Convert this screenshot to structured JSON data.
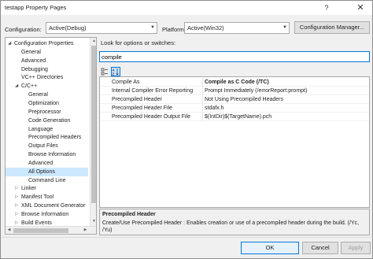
{
  "window": {
    "title": "testapp Property Pages",
    "help_glyph": "?",
    "close_glyph": "✕"
  },
  "config_bar": {
    "configuration_label": "Configuration:",
    "configuration_value": "Active(Debug)",
    "platform_label": "Platform:",
    "platform_value": "Active(Win32)",
    "manager_button": "Configuration Manager..."
  },
  "tree": {
    "items": [
      {
        "label": "Configuration Properties",
        "level": 0,
        "expander": "◢"
      },
      {
        "label": "General",
        "level": 1,
        "expander": ""
      },
      {
        "label": "Advanced",
        "level": 1,
        "expander": ""
      },
      {
        "label": "Debugging",
        "level": 1,
        "expander": ""
      },
      {
        "label": "VC++ Directories",
        "level": 1,
        "expander": ""
      },
      {
        "label": "C/C++",
        "level": 1,
        "expander": "◢"
      },
      {
        "label": "General",
        "level": 2,
        "expander": ""
      },
      {
        "label": "Optimization",
        "level": 2,
        "expander": ""
      },
      {
        "label": "Preprocessor",
        "level": 2,
        "expander": ""
      },
      {
        "label": "Code Generation",
        "level": 2,
        "expander": ""
      },
      {
        "label": "Language",
        "level": 2,
        "expander": ""
      },
      {
        "label": "Precompiled Headers",
        "level": 2,
        "expander": ""
      },
      {
        "label": "Output Files",
        "level": 2,
        "expander": ""
      },
      {
        "label": "Browse Information",
        "level": 2,
        "expander": ""
      },
      {
        "label": "Advanced",
        "level": 2,
        "expander": ""
      },
      {
        "label": "All Options",
        "level": 2,
        "expander": "",
        "selected": true
      },
      {
        "label": "Command Line",
        "level": 2,
        "expander": ""
      },
      {
        "label": "Linker",
        "level": 1,
        "expander": "▷"
      },
      {
        "label": "Manifest Tool",
        "level": 1,
        "expander": "▷"
      },
      {
        "label": "XML Document Generator",
        "level": 1,
        "expander": "▷"
      },
      {
        "label": "Browse Information",
        "level": 1,
        "expander": "▷"
      },
      {
        "label": "Build Events",
        "level": 1,
        "expander": "▷"
      }
    ]
  },
  "search": {
    "hint": "Look for options or switches:",
    "value": "compile"
  },
  "toolbar": {
    "categorized_icon": "categorized-icon",
    "alphabetical_icon": "alphabetical-icon"
  },
  "grid": {
    "rows": [
      {
        "name": "Compile As",
        "value": "Compile as C Code (/TC)",
        "bold": true
      },
      {
        "name": "Internal Compiler Error Reporting",
        "value": "Prompt Immediately (/errorReport:prompt)",
        "bold": false
      },
      {
        "name": "Precompiled Header",
        "value": "Not Using Precompiled Headers",
        "bold": false
      },
      {
        "name": "Precompiled Header File",
        "value": "stdafx.h",
        "bold": false
      },
      {
        "name": "Precompiled Header Output File",
        "value": "$(IntDir)$(TargetName).pch",
        "bold": false
      }
    ]
  },
  "description": {
    "title": "Precompiled Header",
    "text": "Create/Use Precompiled Header : Enables creation or use of a precompiled header during the build. (/Yc, /Yu)"
  },
  "buttons": {
    "ok": "OK",
    "cancel": "Cancel",
    "apply": "Apply"
  },
  "colors": {
    "selection": "#cce8ff",
    "accent": "#0078d7"
  }
}
